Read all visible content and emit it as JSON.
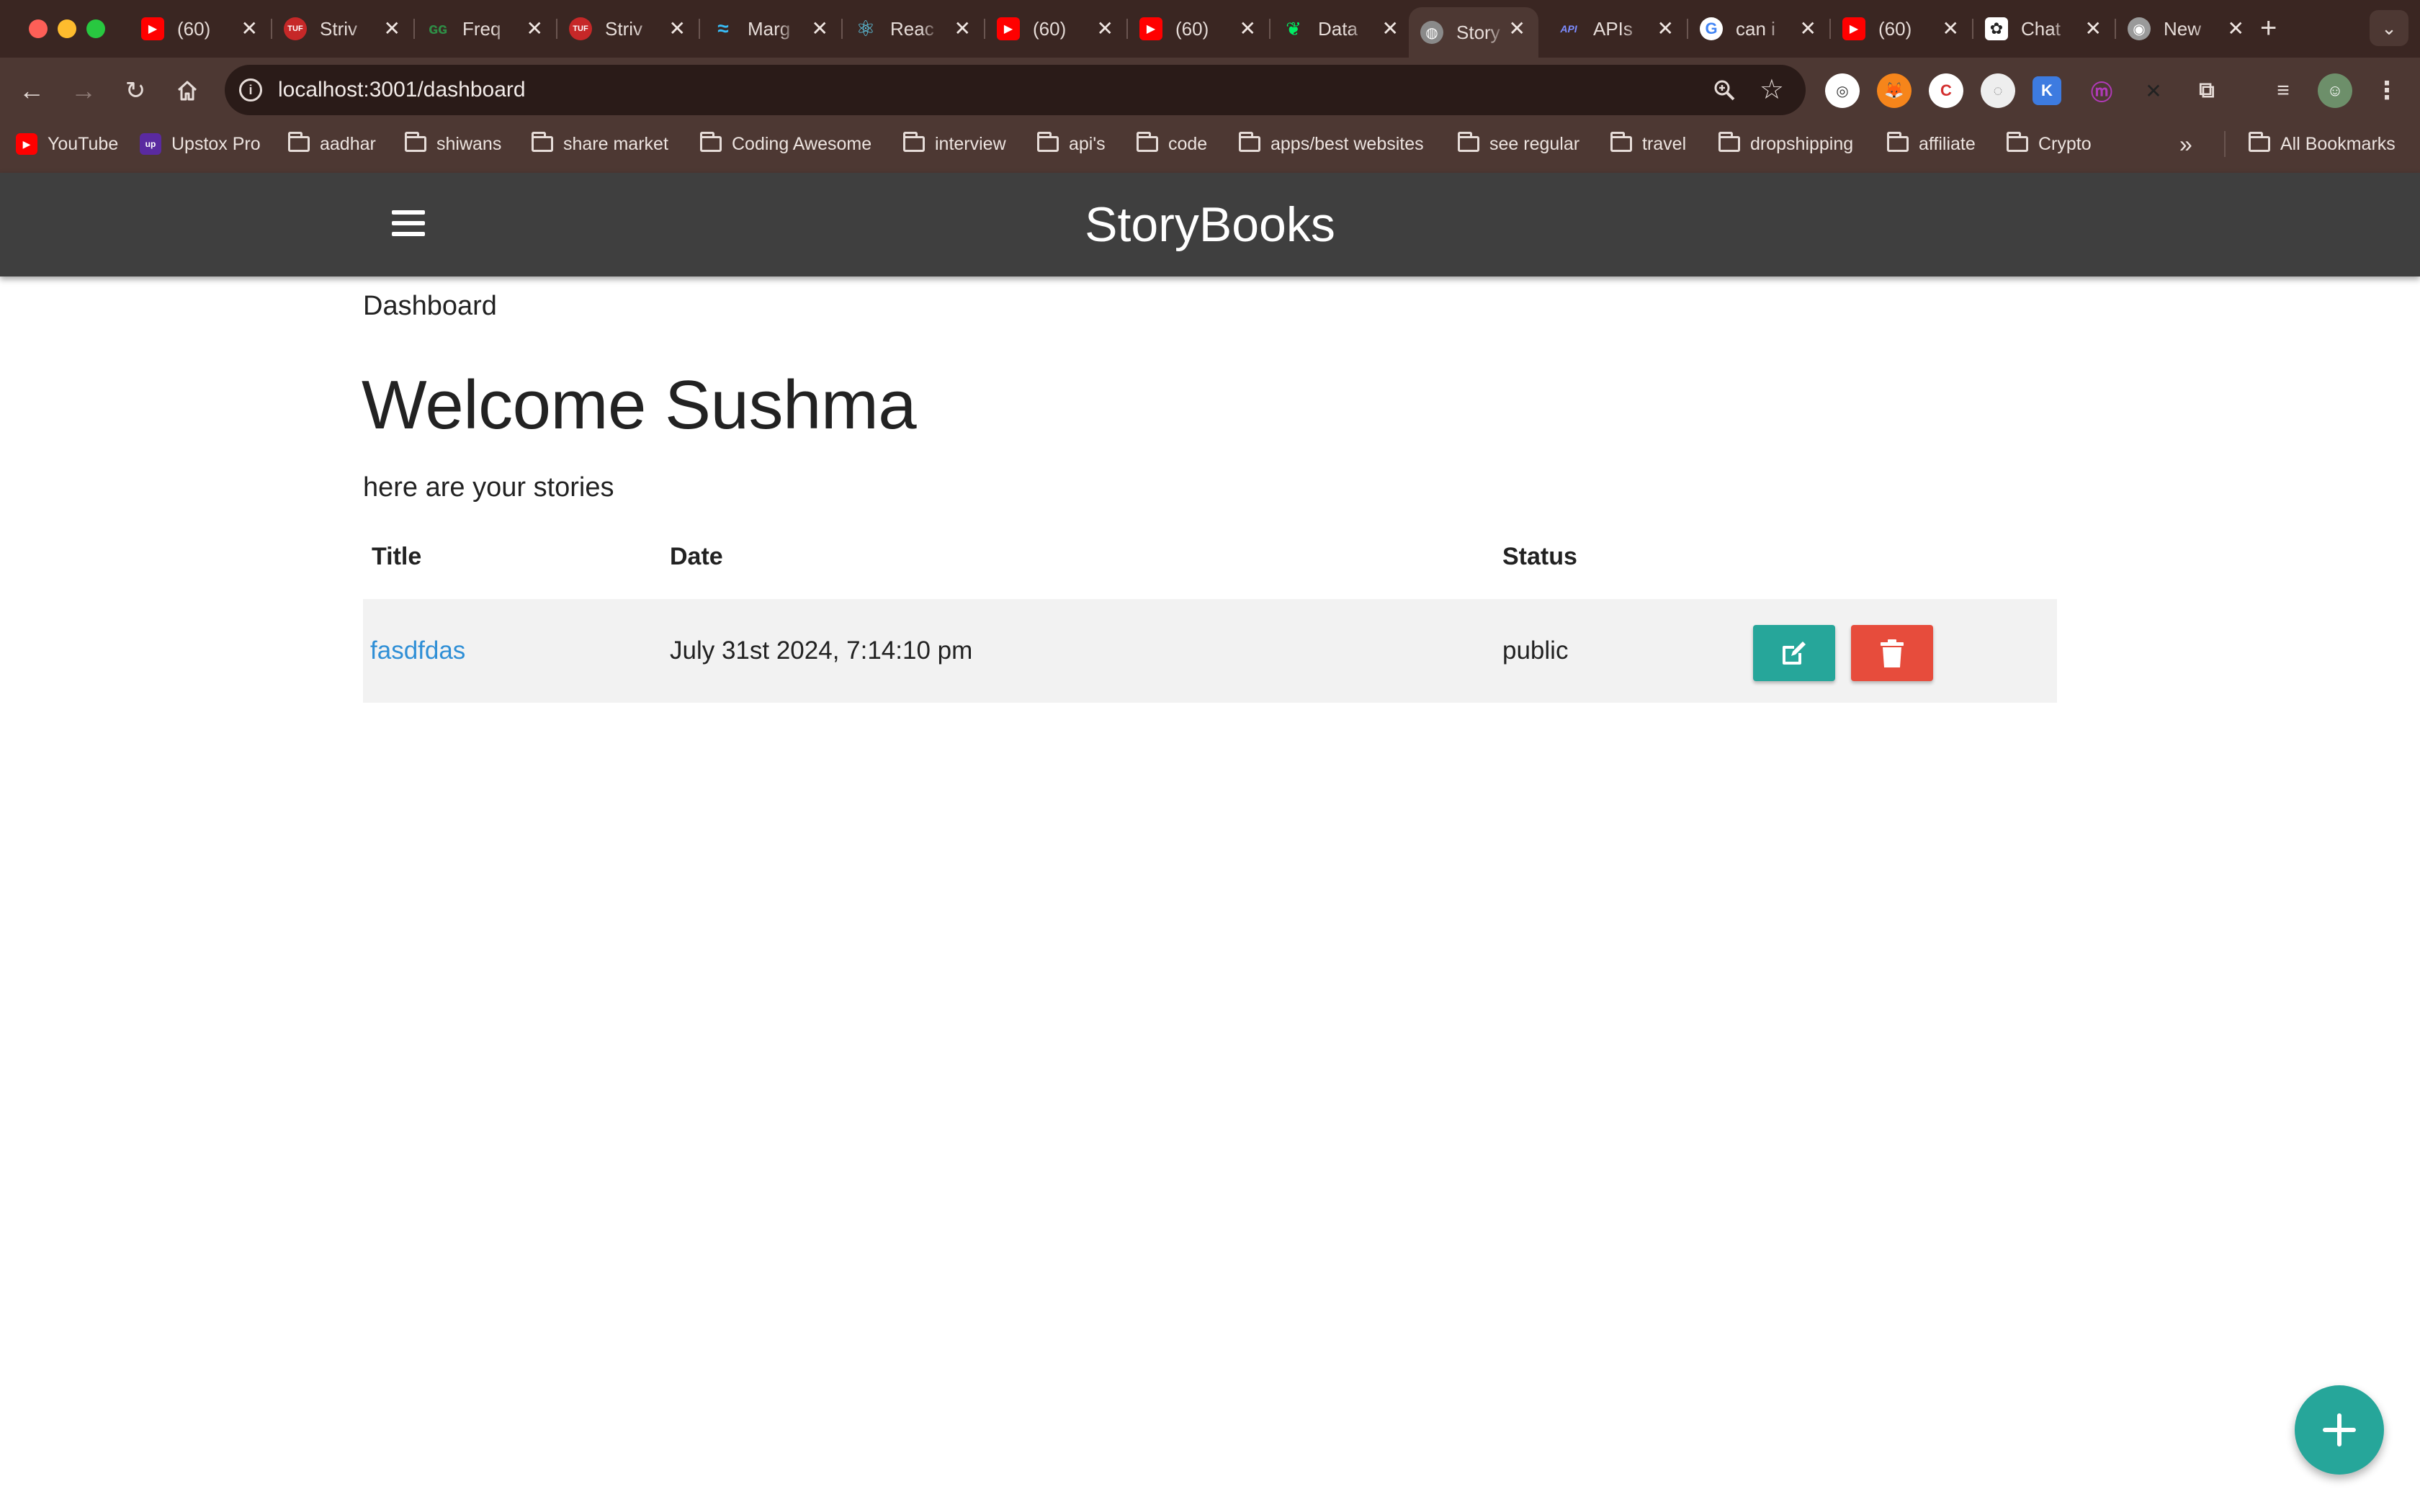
{
  "browser": {
    "tabs": [
      {
        "label": "(60)",
        "favicon": "youtube-icon"
      },
      {
        "label": "Striv",
        "favicon": "tuf-icon"
      },
      {
        "label": "Freq",
        "favicon": "gfg-icon"
      },
      {
        "label": "Striv",
        "favicon": "tuf-icon"
      },
      {
        "label": "Marg",
        "favicon": "tailwind-icon"
      },
      {
        "label": "Reac",
        "favicon": "react-icon"
      },
      {
        "label": "(60)",
        "favicon": "youtube-icon"
      },
      {
        "label": "(60)",
        "favicon": "youtube-icon"
      },
      {
        "label": "Data",
        "favicon": "mongodb-icon"
      },
      {
        "label": "Story",
        "favicon": "globe-icon",
        "active": true
      },
      {
        "label": "APIs",
        "favicon": "api-icon"
      },
      {
        "label": "can i",
        "favicon": "google-icon"
      },
      {
        "label": "(60)",
        "favicon": "youtube-icon"
      },
      {
        "label": "Chat",
        "favicon": "chatgpt-icon"
      },
      {
        "label": "New",
        "favicon": "chrome-icon"
      }
    ],
    "new_tab_symbol": "+",
    "url": "localhost:3001/dashboard",
    "bookmarks": [
      {
        "label": "YouTube",
        "type": "site"
      },
      {
        "label": "Upstox Pro",
        "type": "site"
      },
      {
        "label": "aadhar",
        "type": "folder"
      },
      {
        "label": "shiwans",
        "type": "folder"
      },
      {
        "label": "share market",
        "type": "folder"
      },
      {
        "label": "Coding Awesome",
        "type": "folder"
      },
      {
        "label": "interview",
        "type": "folder"
      },
      {
        "label": "api's",
        "type": "folder"
      },
      {
        "label": "code",
        "type": "folder"
      },
      {
        "label": "apps/best websites",
        "type": "folder"
      },
      {
        "label": "see regular",
        "type": "folder"
      },
      {
        "label": "travel",
        "type": "folder"
      },
      {
        "label": "dropshipping",
        "type": "folder"
      },
      {
        "label": "affiliate",
        "type": "folder"
      },
      {
        "label": "Crypto",
        "type": "folder"
      }
    ],
    "overflow_symbol": "»",
    "all_bookmarks": "All Bookmarks"
  },
  "app": {
    "brand": "StoryBooks",
    "breadcrumb": "Dashboard",
    "welcome": "Welcome Sushma",
    "subtitle": "here are your stories",
    "table": {
      "headers": [
        "Title",
        "Date",
        "Status"
      ],
      "rows": [
        {
          "title": "fasdfdas",
          "date": "July 31st 2024, 7:14:10 pm",
          "status": "public"
        }
      ]
    }
  },
  "colors": {
    "appbar": "#3f3f3f",
    "accent_teal": "#26a69a",
    "danger_red": "#e74c3c",
    "link_blue": "#2f8fd6",
    "row_bg": "#f2f2f2"
  }
}
